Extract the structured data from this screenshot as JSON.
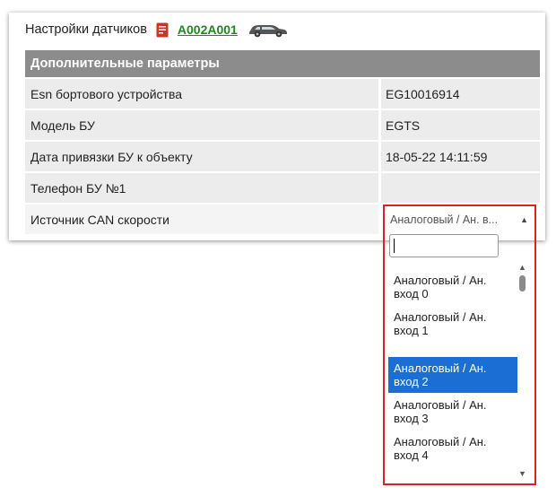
{
  "header": {
    "title": "Настройки датчиков",
    "plate": "А002А001",
    "doc_icon": "document-icon",
    "car_icon": "car-icon"
  },
  "section": {
    "title": "Дополнительные параметры"
  },
  "rows": [
    {
      "label": "Esn бортового устройства",
      "value": "EG10016914"
    },
    {
      "label": "Модель БУ",
      "value": "EGTS"
    },
    {
      "label": "Дата привязки БУ к объекту",
      "value": "18-05-22 14:11:59"
    },
    {
      "label": "Телефон БУ №1",
      "value": ""
    },
    {
      "label": "Источник CAN скорости",
      "value": ""
    }
  ],
  "dropdown": {
    "current": "Аналоговый / Ан. в...",
    "search_value": "",
    "options": [
      {
        "line1": "Аналоговый / Ан.",
        "line2": "вход 0",
        "selected": false
      },
      {
        "line1": "Аналоговый / Ан.",
        "line2": "вход 1",
        "selected": false
      },
      {
        "line1": "Аналоговый / Ан.",
        "line2": "вход 2",
        "selected": true
      },
      {
        "line1": "Аналоговый / Ан.",
        "line2": "вход 3",
        "selected": false
      },
      {
        "line1": "Аналоговый / Ан.",
        "line2": "вход 4",
        "selected": false
      }
    ]
  },
  "colors": {
    "header_bg": "#8c8c8c",
    "row_bg": "#ececec",
    "selected_option": "#1b6ed3",
    "highlight_border": "#e02020",
    "plate_link": "#1a8a1a"
  }
}
